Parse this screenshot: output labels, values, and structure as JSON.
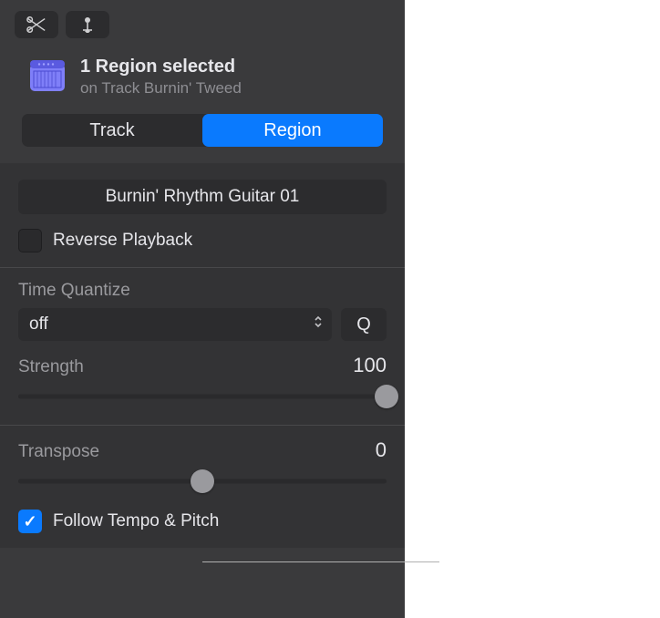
{
  "header": {
    "title": "1 Region selected",
    "subtitle": "on Track Burnin' Tweed"
  },
  "tabs": {
    "track": "Track",
    "region": "Region",
    "active": "region"
  },
  "region_name": "Burnin' Rhythm Guitar 01",
  "reverse_playback": {
    "label": "Reverse Playback",
    "checked": false
  },
  "time_quantize": {
    "label": "Time Quantize",
    "value": "off",
    "q_button": "Q"
  },
  "strength": {
    "label": "Strength",
    "value": "100",
    "slider_percent": 100
  },
  "transpose": {
    "label": "Transpose",
    "value": "0",
    "slider_percent": 50
  },
  "follow_tempo": {
    "label": "Follow Tempo & Pitch",
    "checked": true
  }
}
